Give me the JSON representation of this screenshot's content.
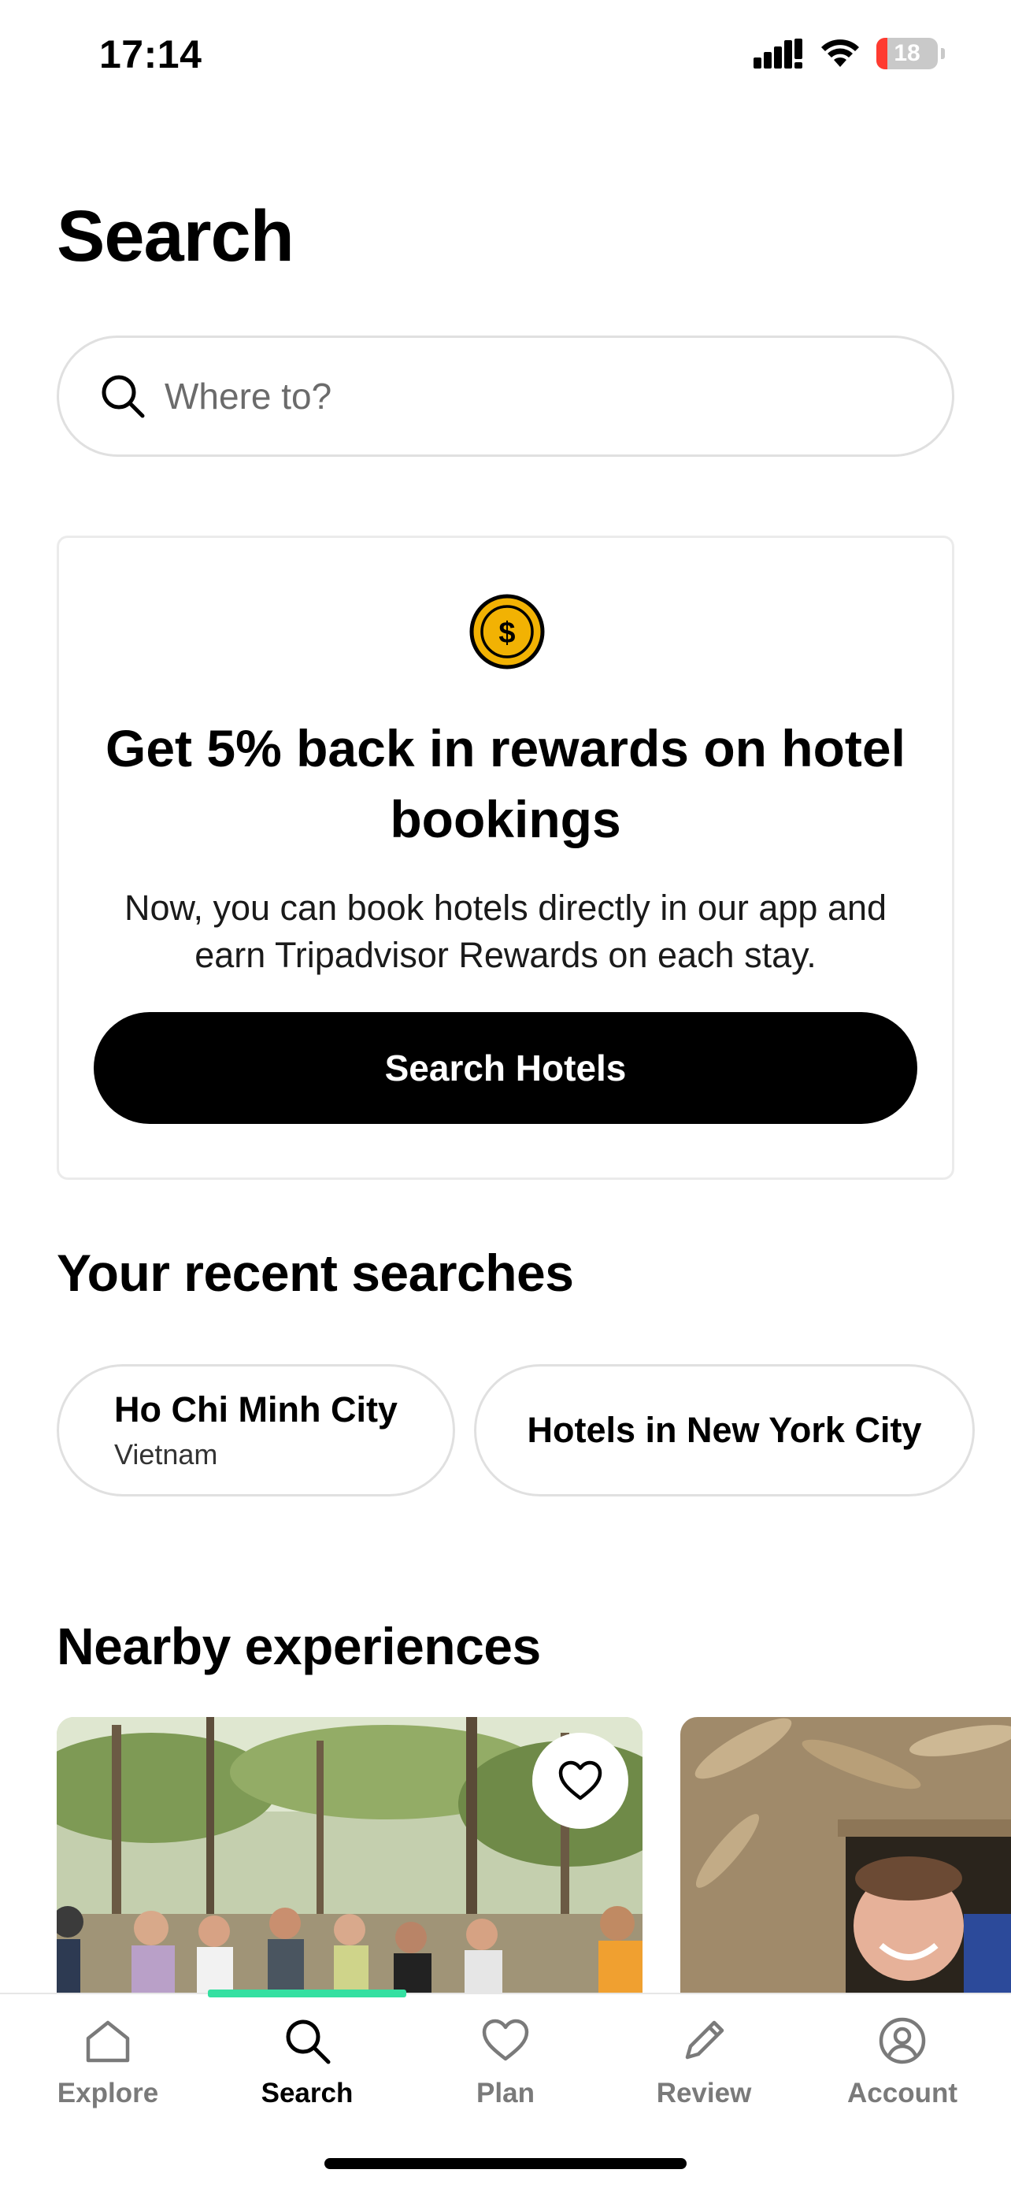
{
  "status_bar": {
    "time": "17:14",
    "battery": "18",
    "battery_level": 0.18
  },
  "page": {
    "title": "Search"
  },
  "search": {
    "placeholder": "Where to?"
  },
  "promo": {
    "heading": "Get 5% back in rewards on hotel bookings",
    "body": "Now, you can book hotels directly in our app and earn Tripadvisor Rewards on each stay.",
    "button_label": "Search Hotels",
    "coin_symbol": "$"
  },
  "recent": {
    "title": "Your recent searches",
    "items": [
      {
        "title": "Ho Chi Minh City",
        "subtitle": "Vietnam"
      },
      {
        "title": "Hotels in New York City"
      }
    ]
  },
  "nearby": {
    "title": "Nearby experiences"
  },
  "tabs": [
    {
      "label": "Explore",
      "icon": "home-icon",
      "active": false
    },
    {
      "label": "Search",
      "icon": "search-icon",
      "active": true
    },
    {
      "label": "Plan",
      "icon": "heart-icon",
      "active": false
    },
    {
      "label": "Review",
      "icon": "pencil-icon",
      "active": false
    },
    {
      "label": "Account",
      "icon": "account-icon",
      "active": false
    }
  ],
  "colors": {
    "accent": "#34e0a1",
    "coin": "#f2b203",
    "battery_low": "#ff3b30"
  }
}
